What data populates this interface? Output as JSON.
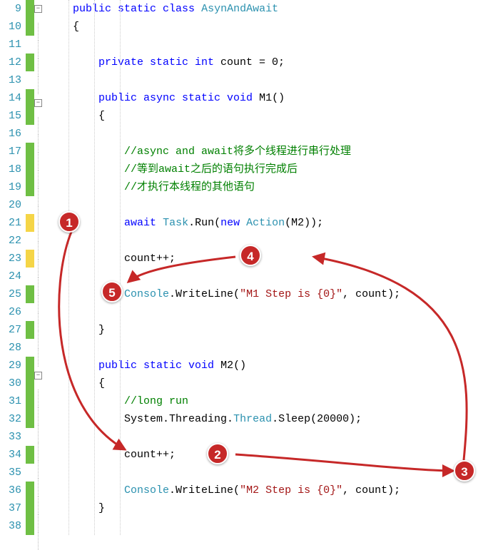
{
  "code": {
    "class_name": "AsynAndAwait",
    "field_decl": {
      "pre": "private static int",
      "name": "count = 0;"
    },
    "m1_sig": {
      "pre": "public async static void",
      "name": "M1()"
    },
    "m2_sig": {
      "pre": "public static void",
      "name": "M2()"
    },
    "comment1": "//async and await将多个线程进行串行处理",
    "comment2": "//等到await之后的语句执行完成后",
    "comment3": "//才执行本线程的其他语句",
    "comment4": "//long run",
    "await_line": {
      "p1": "await",
      "p2": "Task",
      "p3": ".Run(",
      "p4": "new",
      "p5": "Action",
      "p6": "(M2));"
    },
    "countpp": "count++;",
    "console_type": "Console",
    "write_call": ".WriteLine(",
    "m1_str": "\"M1 Step is {0}\"",
    "m2_str": "\"M2 Step is {0}\"",
    "write_tail": ", count);",
    "sleep": {
      "p1": "System.Threading.",
      "p2": "Thread",
      "p3": ".Sleep(20000);"
    },
    "brace_open": "{",
    "brace_close": "}",
    "class_kw": "public static class"
  },
  "layout": {
    "line_numbers": [
      9,
      10,
      11,
      12,
      13,
      14,
      15,
      16,
      17,
      18,
      19,
      20,
      21,
      22,
      23,
      24,
      25,
      26,
      27,
      28,
      29,
      30,
      31,
      32,
      33,
      34,
      35,
      36,
      37,
      38
    ],
    "markers": [
      "green",
      "green",
      "",
      "green",
      "",
      "green",
      "green",
      "",
      "green",
      "green",
      "green",
      "",
      "yellow",
      "",
      "yellow",
      "",
      "green",
      "",
      "green",
      "",
      "green",
      "green",
      "green",
      "green",
      "",
      "green",
      "",
      "green",
      "green",
      "green"
    ],
    "fold_boxes": [
      0,
      5,
      20
    ]
  },
  "badges": {
    "b1": "1",
    "b2": "2",
    "b3": "3",
    "b4": "4",
    "b5": "5"
  }
}
